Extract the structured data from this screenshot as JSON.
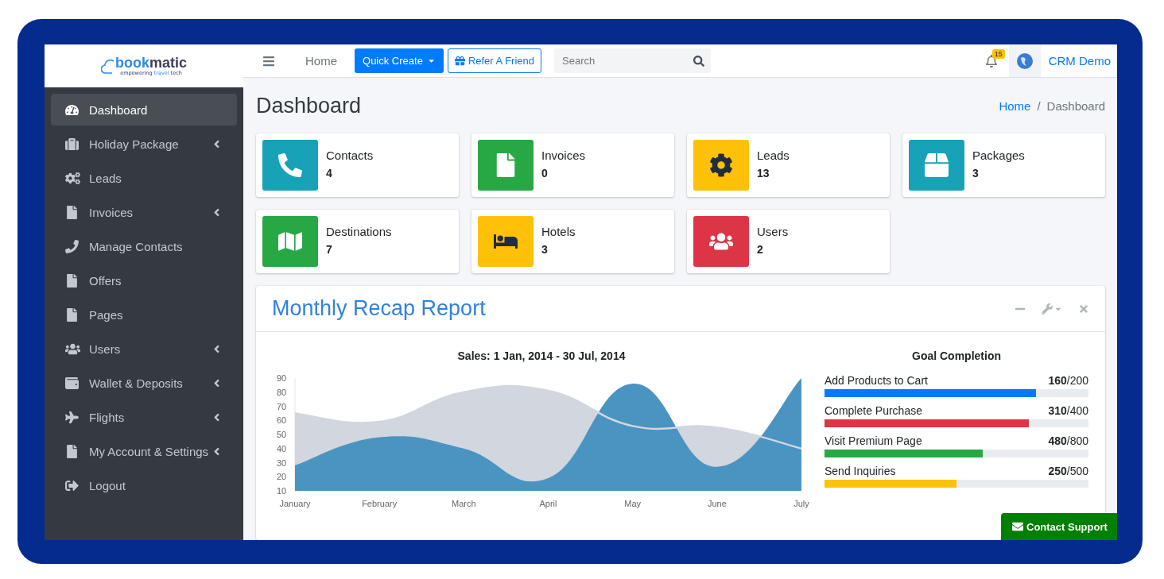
{
  "brand": {
    "wordmark": [
      "book",
      "matic"
    ],
    "tagline": [
      "empowering ",
      "travel",
      " tech"
    ]
  },
  "sidebar": {
    "items": [
      {
        "label": "Dashboard",
        "selected": true,
        "expandable": false
      },
      {
        "label": "Holiday Package",
        "selected": false,
        "expandable": true
      },
      {
        "label": "Leads",
        "selected": false,
        "expandable": false
      },
      {
        "label": "Invoices",
        "selected": false,
        "expandable": true
      },
      {
        "label": "Manage Contacts",
        "selected": false,
        "expandable": false
      },
      {
        "label": "Offers",
        "selected": false,
        "expandable": false
      },
      {
        "label": "Pages",
        "selected": false,
        "expandable": false
      },
      {
        "label": "Users",
        "selected": false,
        "expandable": true
      },
      {
        "label": "Wallet & Deposits",
        "selected": false,
        "expandable": true
      },
      {
        "label": "Flights",
        "selected": false,
        "expandable": true
      },
      {
        "label": "My Account & Settings",
        "selected": false,
        "expandable": true
      },
      {
        "label": "Logout",
        "selected": false,
        "expandable": false
      }
    ]
  },
  "topbar": {
    "home_link": "Home",
    "quick_create": "Quick Create",
    "refer": "Refer A Friend",
    "search": {
      "placeholder": "Search"
    },
    "notification_count": "15",
    "user": "CRM Demo"
  },
  "page": {
    "title": "Dashboard",
    "breadcrumb_separator": "/",
    "breadcrumb": [
      {
        "label": "Home",
        "link": true
      },
      {
        "label": "Dashboard",
        "link": false
      }
    ]
  },
  "info_boxes": [
    {
      "label": "Contacts",
      "value": "4",
      "color": "#17a2b8"
    },
    {
      "label": "Invoices",
      "value": "0",
      "color": "#28a745"
    },
    {
      "label": "Leads",
      "value": "13",
      "color": "#ffc107"
    },
    {
      "label": "Packages",
      "value": "3",
      "color": "#17a2b8"
    },
    {
      "label": "Destinations",
      "value": "7",
      "color": "#28a745"
    },
    {
      "label": "Hotels",
      "value": "3",
      "color": "#ffc107"
    },
    {
      "label": "Users",
      "value": "2",
      "color": "#dc3545"
    }
  ],
  "report": {
    "title": "Monthly Recap Report",
    "chart_data": {
      "type": "area",
      "title": "Sales: 1 Jan, 2014 - 30 Jul, 2014",
      "categories": [
        "January",
        "February",
        "March",
        "April",
        "May",
        "June",
        "July"
      ],
      "series": [
        {
          "color": "#d2d6de",
          "values": [
            65,
            59,
            80,
            81,
            56,
            55,
            40
          ]
        },
        {
          "color": "#4a94c2",
          "values": [
            28,
            48,
            40,
            19,
            86,
            27,
            90
          ]
        }
      ],
      "ylim": [
        10,
        90
      ],
      "yticks": [
        10,
        20,
        30,
        40,
        50,
        60,
        70,
        80,
        90
      ]
    },
    "goals": {
      "title": "Goal Completion",
      "items": [
        {
          "label": "Add Products to Cart",
          "value": "**160**/200",
          "level": 0.8,
          "color": "#007bff"
        },
        {
          "label": "Complete Purchase",
          "value": "**310**/400",
          "level": 0.775,
          "color": "#dc3545"
        },
        {
          "label": "Visit Premium Page",
          "value": "**480**/800",
          "level": 0.6,
          "color": "#28a745"
        },
        {
          "label": "Send Inquiries",
          "value": "**250**/500",
          "level": 0.5,
          "color": "#ffc107"
        }
      ]
    }
  },
  "support_button": "Contact Support"
}
